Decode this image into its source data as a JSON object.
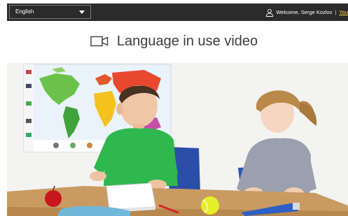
{
  "header": {
    "language_selected": "English",
    "welcome_text": "Welcome, Serge Kozlov",
    "separator": "|",
    "truncated_link": "You"
  },
  "page": {
    "title": "Language in use video"
  },
  "icons": {
    "user": "user-icon",
    "video": "video-camera-icon",
    "dropdown": "chevron-down-icon"
  },
  "colors": {
    "topbar_bg": "#2b2b2b",
    "link_accent": "#ffd84a",
    "title_text": "#3c3c3c"
  }
}
